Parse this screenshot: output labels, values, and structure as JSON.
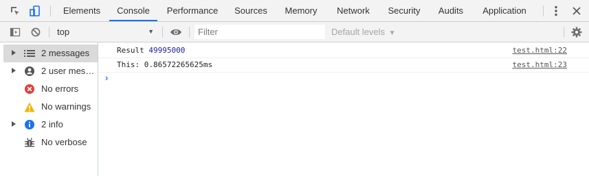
{
  "tabs": [
    {
      "label": "Elements"
    },
    {
      "label": "Console"
    },
    {
      "label": "Performance"
    },
    {
      "label": "Sources"
    },
    {
      "label": "Memory"
    },
    {
      "label": "Network"
    },
    {
      "label": "Security"
    },
    {
      "label": "Audits"
    },
    {
      "label": "Application"
    }
  ],
  "active_tab": "Console",
  "toolbar": {
    "context": "top",
    "filter_placeholder": "Filter",
    "levels_label": "Default levels"
  },
  "sidebar": {
    "items": [
      {
        "label": "2 messages",
        "icon": "list-icon",
        "expandable": true,
        "selected": true
      },
      {
        "label": "2 user mess…",
        "icon": "user-icon",
        "expandable": true,
        "selected": false
      },
      {
        "label": "No errors",
        "icon": "error-icon",
        "expandable": false,
        "selected": false
      },
      {
        "label": "No warnings",
        "icon": "warning-icon",
        "expandable": false,
        "selected": false
      },
      {
        "label": "2 info",
        "icon": "info-icon",
        "expandable": true,
        "selected": false
      },
      {
        "label": "No verbose",
        "icon": "bug-icon",
        "expandable": false,
        "selected": false
      }
    ]
  },
  "console": {
    "messages": [
      {
        "prefix": "Result ",
        "value": "49995000",
        "source": "test.html:22"
      },
      {
        "prefix": "This: 0.86572265625ms",
        "value": "",
        "source": "test.html:23"
      }
    ],
    "prompt": "›"
  },
  "colors": {
    "accent": "#1a73e8",
    "error": "#e33e3e",
    "warning": "#f4b400",
    "info": "#1a73e8",
    "number": "#1a1aa6"
  }
}
